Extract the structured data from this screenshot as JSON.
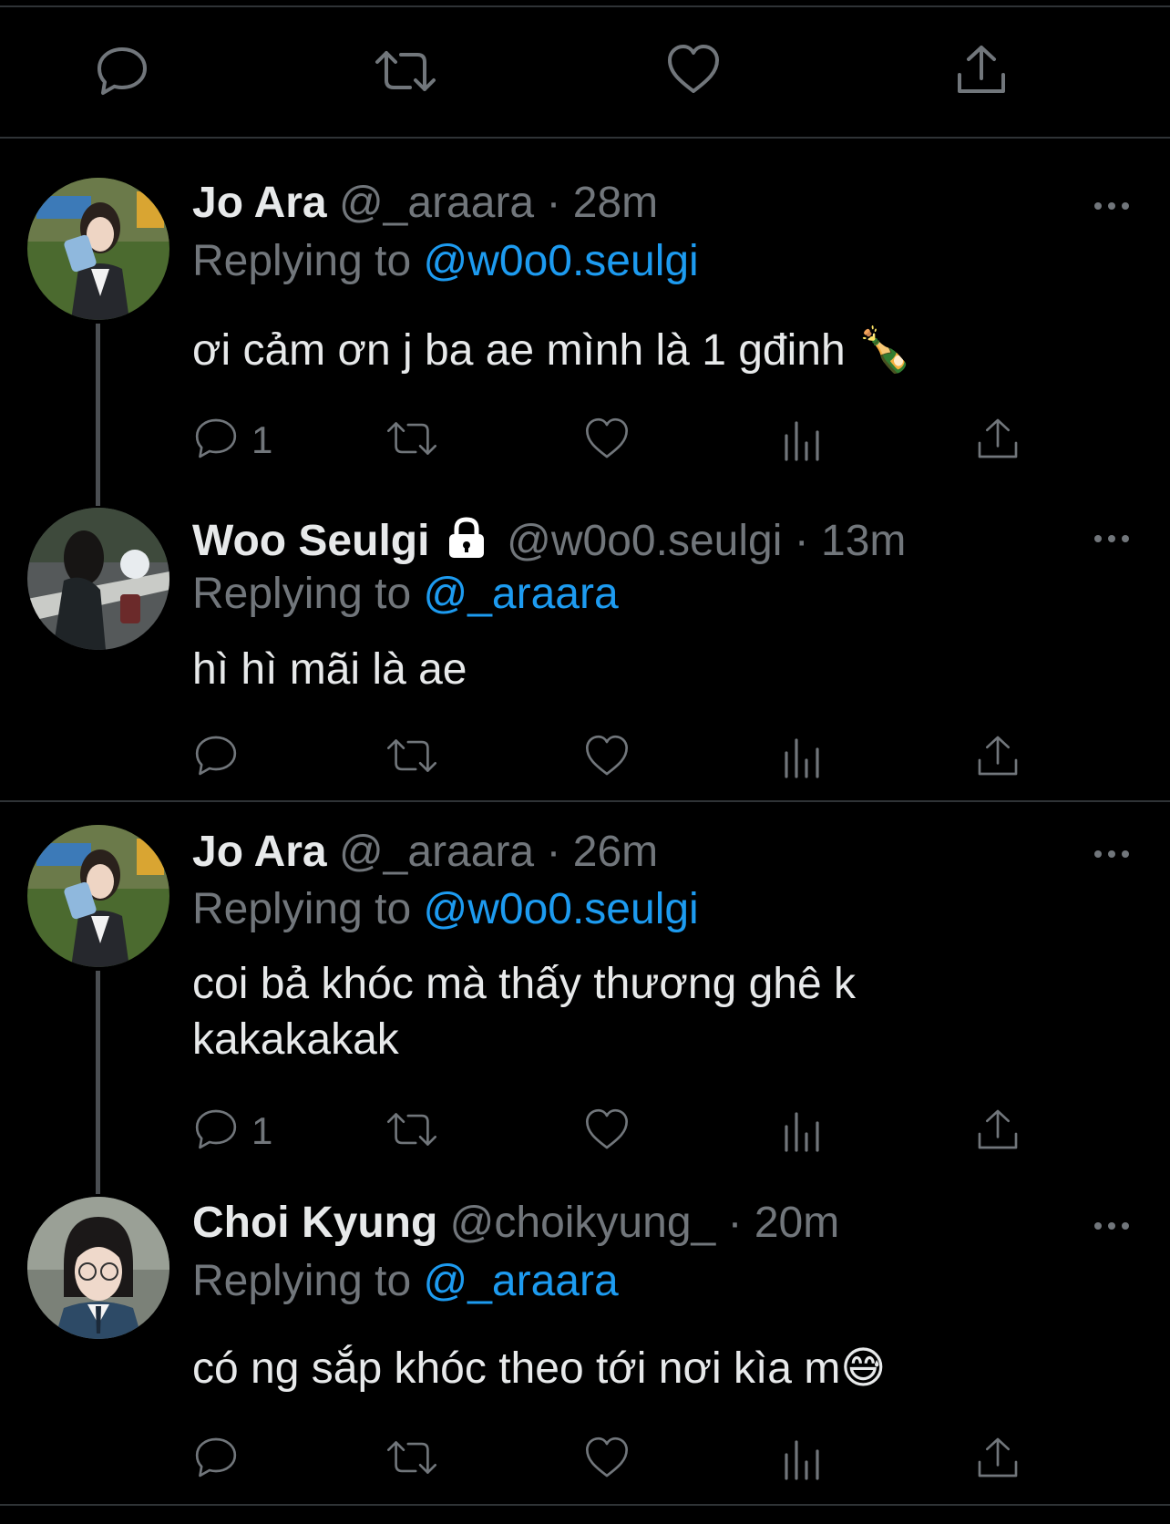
{
  "top_actions": [
    "reply-icon",
    "retweet-icon",
    "like-icon",
    "share-icon"
  ],
  "tweets": [
    {
      "name": "Jo Ara",
      "meta": "@_araara · 28m",
      "replying_prefix": "Replying to ",
      "replying_to": "@w0o0.seulgi",
      "text_lines": [
        "ơi cảm ơn j ba ae mình là 1 gđinh 🍾"
      ],
      "reply_count": "1",
      "avatar": "avatar-jo-ara"
    },
    {
      "name": "Woo Seulgi",
      "meta": "@w0o0.seulgi · 13m",
      "protected": "lock-icon",
      "replying_prefix": "Replying to ",
      "replying_to": "@_araara",
      "text_lines": [
        "hì hì mãi là ae"
      ],
      "reply_count": "",
      "avatar": "avatar-woo-seulgi"
    },
    {
      "name": "Jo Ara",
      "meta": "@_araara · 26m",
      "replying_prefix": "Replying to ",
      "replying_to": "@w0o0.seulgi",
      "text_lines": [
        "coi bả khóc mà thấy thương ghê k",
        "kakakakak"
      ],
      "reply_count": "1",
      "avatar": "avatar-jo-ara"
    },
    {
      "name": "Choi Kyung",
      "meta": "@choikyung_ · 20m",
      "replying_prefix": "Replying to ",
      "replying_to": "@_araara",
      "text_lines": [
        "có ng sắp khóc theo tới nơi kìa m😅"
      ],
      "reply_count": "",
      "avatar": "avatar-choi-kyung"
    }
  ],
  "colors": {
    "background": "#000000",
    "primary_text": "#e7e9ea",
    "secondary_text": "#71767b",
    "mention": "#1d9bf0",
    "divider": "#2f3336"
  }
}
